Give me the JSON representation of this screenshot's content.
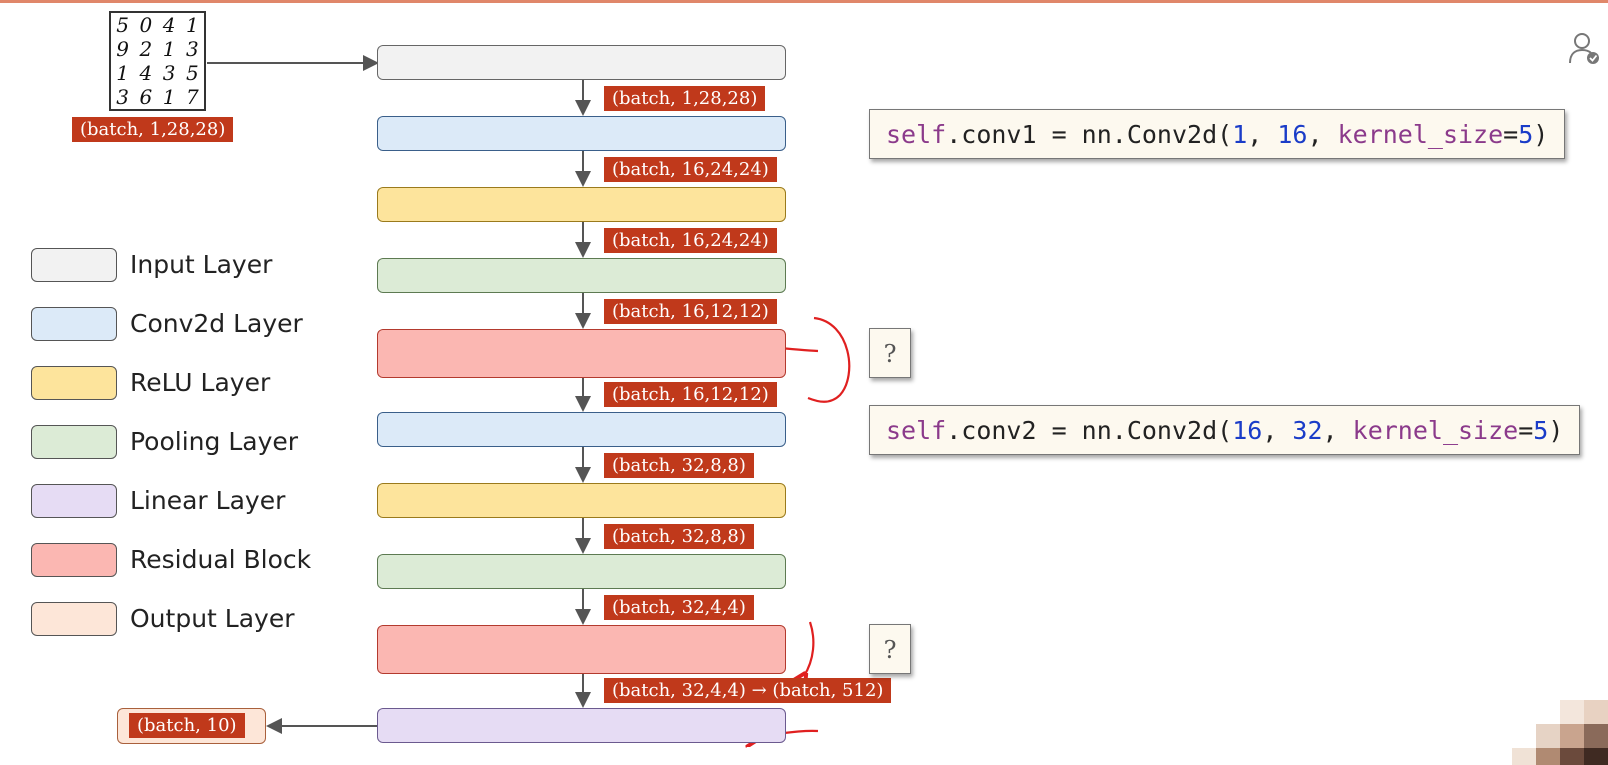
{
  "input_digits": [
    "5",
    "0",
    "4",
    "1",
    "9",
    "2",
    "1",
    "3",
    "1",
    "4",
    "3",
    "5",
    "3",
    "6",
    "1",
    "7"
  ],
  "input_shape": "(batch, 1,28,28)",
  "shapes": [
    "(batch, 1,28,28)",
    "(batch, 16,24,24)",
    "(batch, 16,24,24)",
    "(batch, 16,12,12)",
    "(batch, 16,12,12)",
    "(batch, 32,8,8)",
    "(batch, 32,8,8)",
    "(batch, 32,4,4)",
    "(batch, 32,4,4) → (batch, 512)"
  ],
  "output_shape": "(batch, 10)",
  "legend": [
    {
      "label": "Input Layer",
      "color": "#f2f2f2"
    },
    {
      "label": "Conv2d Layer",
      "color": "#dceaf8"
    },
    {
      "label": "ReLU Layer",
      "color": "#fde49c"
    },
    {
      "label": "Pooling Layer",
      "color": "#dcebd6"
    },
    {
      "label": "Linear Layer",
      "color": "#e6dcf4"
    },
    {
      "label": "Residual Block",
      "color": "#fbb7b2"
    },
    {
      "label": "Output Layer",
      "color": "#fde6d8"
    }
  ],
  "layers": [
    "input",
    "conv2d",
    "relu",
    "pooling",
    "residual",
    "conv2d",
    "relu",
    "pooling",
    "residual",
    "linear"
  ],
  "code": {
    "conv1": {
      "lhs": "self",
      "attr": ".conv1 = nn.Conv2d(",
      "a1": "1",
      "a2": "16",
      "kw": "kernel_size",
      "kv": "5"
    },
    "conv2": {
      "lhs": "self",
      "attr": ".conv2 = nn.Conv2d(",
      "a1": "16",
      "a2": "32",
      "kw": "kernel_size",
      "kv": "5"
    }
  },
  "question_mark": "?",
  "colors": {
    "shape_label_bg": "#c0391b",
    "annotation_red": "#e02020",
    "top_line": "#e0876a"
  }
}
